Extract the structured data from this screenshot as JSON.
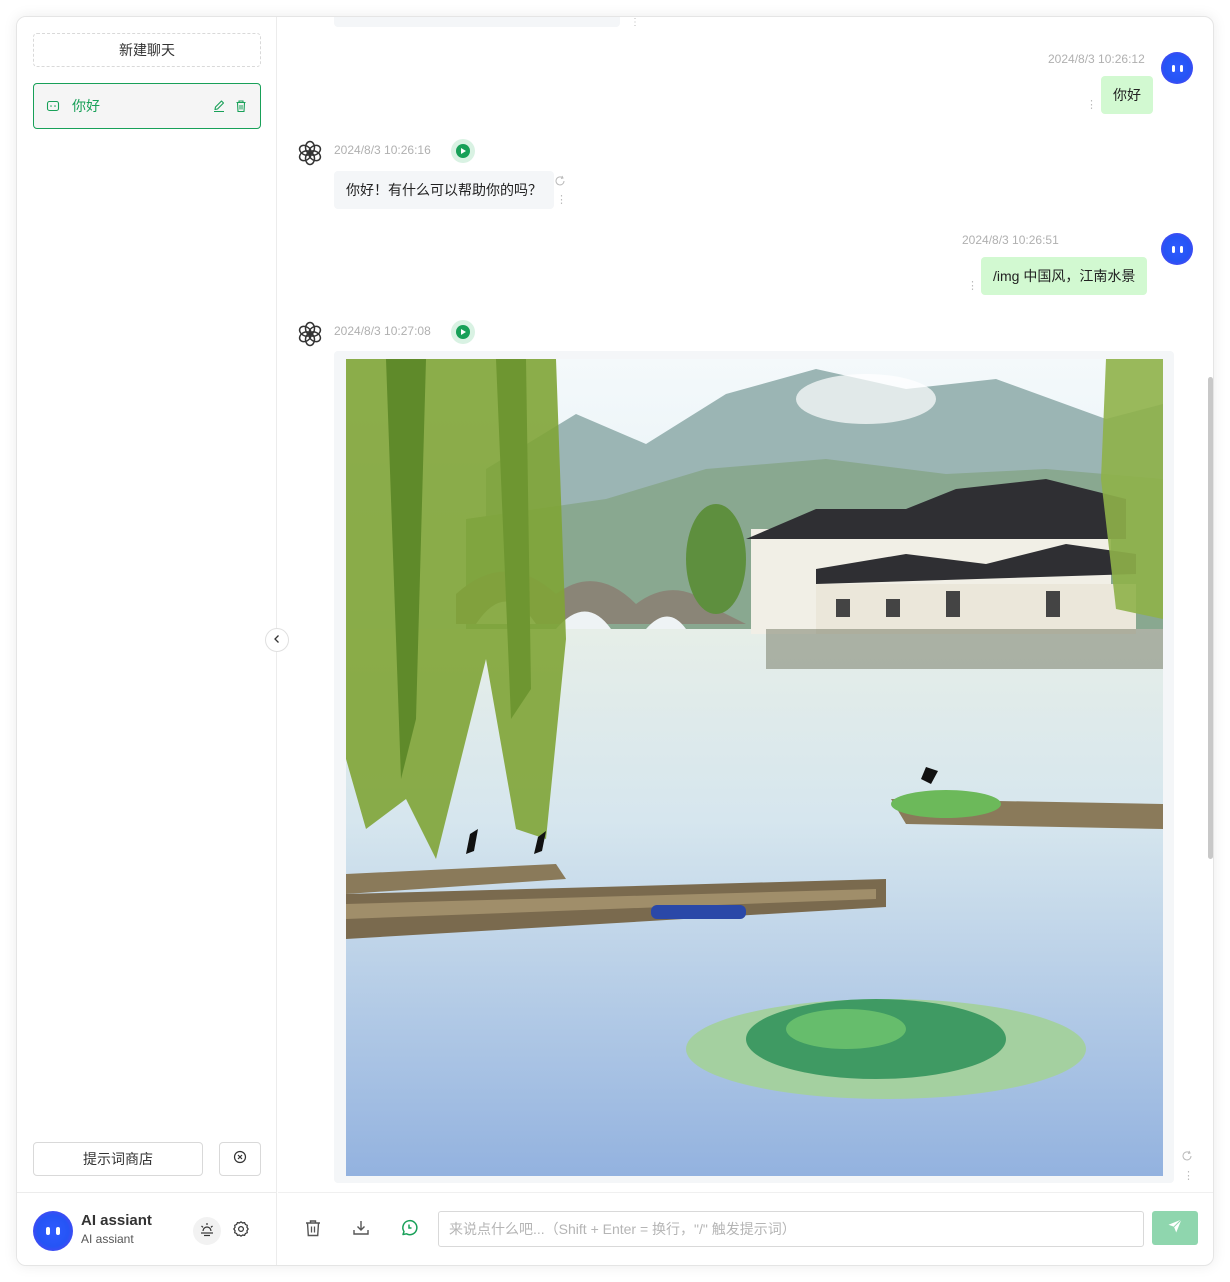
{
  "sidebar": {
    "new_chat_label": "新建聊天",
    "sessions": [
      {
        "title": "你好",
        "active": true
      }
    ],
    "prompt_store_label": "提示词商店",
    "user": {
      "name": "AI assiant",
      "description": "AI assiant"
    }
  },
  "messages": [
    {
      "role": "user",
      "time": "2024/8/3 10:26:12",
      "text": "你好"
    },
    {
      "role": "assistant",
      "time": "2024/8/3 10:26:16",
      "text": "你好！有什么可以帮助你的吗？"
    },
    {
      "role": "user",
      "time": "2024/8/3 10:26:51",
      "text": "/img 中国风，江南水景"
    },
    {
      "role": "assistant",
      "time": "2024/8/3 10:27:08",
      "image": "generated-image"
    }
  ],
  "input": {
    "placeholder": "来说点什么吧...（Shift + Enter = 换行，\"/\" 触发提示词）",
    "value": ""
  },
  "colors": {
    "accent": "#18a058",
    "user_bubble": "#d2f9d1",
    "bot_bubble": "#f4f6f8",
    "send_button": "#8fd6ae"
  },
  "icons": {
    "session": "chat-icon",
    "edit": "edit-icon",
    "delete": "trash-icon",
    "close": "close-circle-icon",
    "theme": "sun-icon",
    "settings": "gear-icon",
    "collapse": "chevron-left-icon",
    "assistant_avatar": "openai-logo-icon",
    "play": "play-icon",
    "more": "more-vertical-icon",
    "regenerate": "refresh-icon",
    "clear": "trash-icon",
    "download": "download-icon",
    "context": "context-icon",
    "send": "send-icon"
  }
}
